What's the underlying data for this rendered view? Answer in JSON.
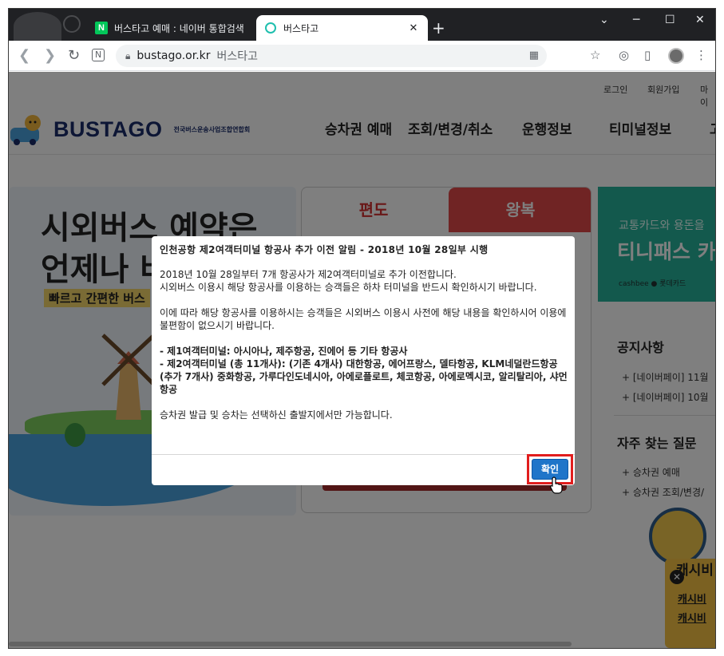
{
  "browser": {
    "tabs": [
      {
        "title": "버스타고 예매 : 네이버 통합검색",
        "icon": "naver-n-icon",
        "close": "✕"
      },
      {
        "title": "버스타고",
        "icon": "loading-ring-icon",
        "close": "✕"
      }
    ],
    "new_tab": "+",
    "controls": {
      "list": "⌄",
      "minimize": "─",
      "maximize": "☐",
      "close": "✕"
    },
    "url": "bustago.or.kr",
    "site_name": "버스타고"
  },
  "site": {
    "util_links": [
      "로그인",
      "회원가입",
      "마이"
    ],
    "logo_text": "BUSTAGO",
    "logo_sub": "전국버스운송사업조합연합회",
    "nav": [
      "승차권 예매",
      "조회/변경/취소",
      "운행정보",
      "티미널정보",
      "고"
    ],
    "banner": {
      "line1": "시외버스 예약은",
      "line2": "언제나 버",
      "sub": "빠르고 간편한 버스"
    },
    "booking_tabs": [
      "편도",
      "왕복"
    ],
    "promo": {
      "line1": "교통카드와 용돈을",
      "line2": "티니패스 카",
      "line3": "cashbee ● 롯데카드"
    },
    "notice": {
      "title": "공지사항",
      "items": [
        "+ [네이버페이] 11월 ",
        "+ [네이버페이] 10월 "
      ]
    },
    "faq": {
      "title": "자주 찾는 질문",
      "items": [
        "+ 승차권 예매",
        "+ 승차권 조회/변경/"
      ]
    },
    "cashbee": {
      "title": "캐시비",
      "close": "✕",
      "lines": [
        "캐시비 ",
        "캐시비 "
      ]
    }
  },
  "modal": {
    "title": "인천공항 제2여객터미널 항공사 추가 이전 알림 - 2018년 10월 28일부 시행",
    "para1": "2018년 10월 28일부터 7개 항공사가 제2여객터미널로 추가 이전합니다.\n시외버스 이용시 해당 항공사를 이용하는 승객들은 하차 터미널을 반드시 확인하시기 바랍니다.",
    "para2": "이에 따라 해당 항공사를 이용하시는 승객들은 시외버스 이용시 사전에 해당 내용을 확인하시어 이용에 불편함이 없으시기 바랍니다.",
    "list": "- 제1여객터미널: 아시아나, 제주항공, 진에어 등 기타 항공사\n- 제2여객터미널 (총 11개사): (기존 4개사) 대한항공, 에어프랑스, 델타항공, KLM네덜란드항공\n(추가 7개사) 중화항공, 가루다인도네시아, 아에로플로트, 체코항공, 아에로멕시코, 알리탈리아, 샤먼항공",
    "para3": "승차권 발급 및 승차는 선택하신 출발지에서만 가능합니다.",
    "confirm": "확인"
  }
}
